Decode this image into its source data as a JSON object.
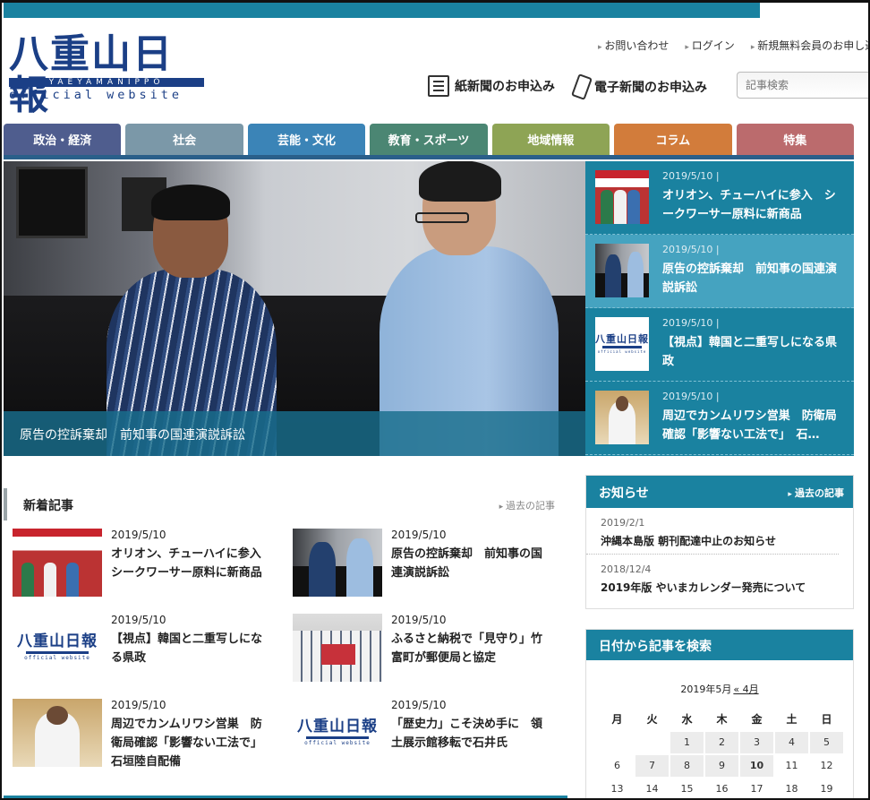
{
  "header": {
    "logo": {
      "title": "八重山日報",
      "band": "YAEYAMANIPPO",
      "subtitle": "official website"
    },
    "toplinks": [
      "お問い合わせ",
      "ログイン",
      "新規無料会員のお申し込"
    ],
    "subscribe_paper": "紙新聞のお申込み",
    "subscribe_digital": "電子新聞のお申込み",
    "search_placeholder": "記事検索"
  },
  "nav": [
    {
      "label": "政治・経済",
      "color": "#4f5d8e"
    },
    {
      "label": "社会",
      "color": "#7b98a8"
    },
    {
      "label": "芸能・文化",
      "color": "#3b84b7"
    },
    {
      "label": "教育・スポーツ",
      "color": "#4b8673"
    },
    {
      "label": "地域情報",
      "color": "#8ea455"
    },
    {
      "label": "コラム",
      "color": "#d27c3b"
    },
    {
      "label": "特集",
      "color": "#bb6b6d"
    }
  ],
  "hero": {
    "caption": "原告の控訴棄却　前知事の国連演説訴訟"
  },
  "hero_side": [
    {
      "date": "2019/5/10",
      "title": "オリオン、チューハイに参入　シークワーサー原料に新商品",
      "thumb": "ad"
    },
    {
      "date": "2019/5/10",
      "title": "原告の控訴棄却　前知事の国連演説訴訟",
      "thumb": "meet"
    },
    {
      "date": "2019/5/10",
      "title": "【視点】韓国と二重写しになる県政",
      "thumb": "logo"
    },
    {
      "date": "2019/5/10",
      "title": "周辺でカンムリワシ営巣　防衛局確認「影響ない工法で」　石…",
      "thumb": "police"
    }
  ],
  "latest": {
    "title": "新着記事",
    "past_link": "過去の記事",
    "items": [
      {
        "date": "2019/5/10",
        "title": "オリオン、チューハイに参入　シークワーサー原料に新商品",
        "thumb": "ad"
      },
      {
        "date": "2019/5/10",
        "title": "原告の控訴棄却　前知事の国連演説訴訟",
        "thumb": "meet"
      },
      {
        "date": "2019/5/10",
        "title": "【視点】韓国と二重写しになる県政",
        "thumb": "logo"
      },
      {
        "date": "2019/5/10",
        "title": "ふるさと納税で「見守り」竹富町が郵便局と協定",
        "thumb": "group"
      },
      {
        "date": "2019/5/10",
        "title": "周辺でカンムリワシ営巣　防衛局確認「影響ない工法で」　石垣陸自配備",
        "thumb": "police"
      },
      {
        "date": "2019/5/10",
        "title": "「歴史力」こそ決め手に　領土展示館移転で石井氏",
        "thumb": "logo"
      }
    ]
  },
  "notices": {
    "title": "お知らせ",
    "past_link": "過去の記事",
    "items": [
      {
        "date": "2019/2/1",
        "title": "沖縄本島版 朝刊配達中止のお知らせ"
      },
      {
        "date": "2018/12/4",
        "title": "2019年版 やいまカレンダー発売について"
      }
    ]
  },
  "calendar": {
    "title": "日付から記事を検索",
    "caption": "2019年5月",
    "prev_link": "« 4月",
    "weekdays": [
      "月",
      "火",
      "水",
      "木",
      "金",
      "土",
      "日"
    ],
    "cells": [
      "",
      "",
      "1",
      "2",
      "3",
      "4",
      "5",
      "6",
      "7",
      "8",
      "9",
      "10",
      "11",
      "12",
      "13",
      "14",
      "15",
      "16",
      "17",
      "18",
      "19"
    ],
    "linked_days": [
      "1",
      "2",
      "3",
      "4",
      "5",
      "7",
      "8",
      "9",
      "10"
    ],
    "current_day": "10"
  }
}
